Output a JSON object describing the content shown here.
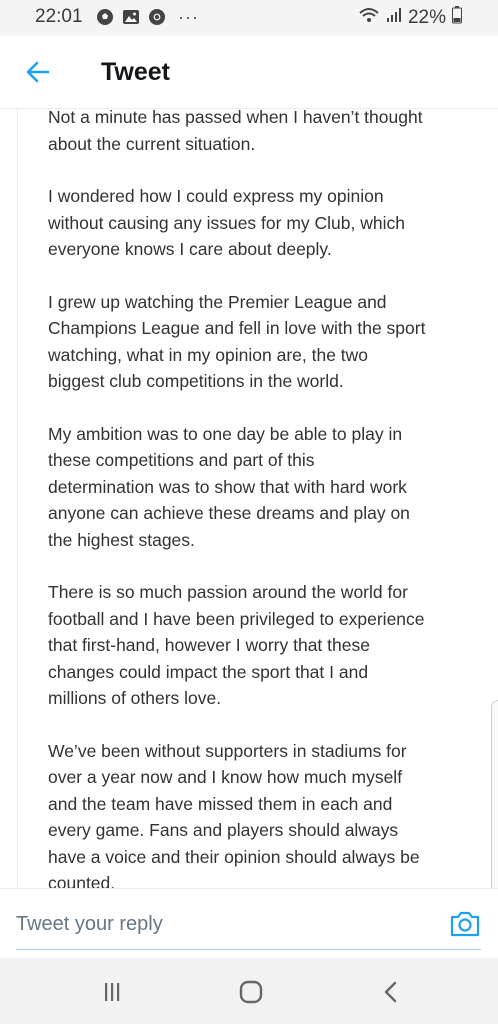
{
  "status_bar": {
    "time": "22:01",
    "icons_left": [
      "soccer-ball-icon",
      "gallery-icon",
      "chrome-icon",
      "more-dots-icon"
    ],
    "more_dots": "···",
    "battery_percent": "22%"
  },
  "header": {
    "title": "Tweet",
    "accent_color": "#1da1f2"
  },
  "tweet": {
    "paragraphs": [
      "Not a minute has passed when I haven’t thought\nabout the current situation.",
      "I wondered how I could express my opinion\nwithout causing any issues for my Club, which\neveryone knows I care about deeply.",
      "I grew up watching the Premier League and\nChampions League and fell in love with the sport\nwatching, what in my opinion are, the two\nbiggest club competitions in the world.",
      "My ambition was to one day be able to play in\nthese competitions and part of this\ndetermination was to show that with hard work\nanyone can achieve these dreams and play on\nthe highest stages.",
      "There is so much passion around the world for\nfootball and I have been privileged to experience\nthat first-hand, however I worry that these\nchanges could impact the sport that I and\nmillions of others love.",
      "We’ve been without supporters in stadiums for\nover a year now and I know how much myself\nand the team have missed them in each and\nevery game. Fans and players should always\nhave a voice and their opinion should always be\ncounted."
    ]
  },
  "reply": {
    "placeholder": "Tweet your reply"
  },
  "nav": {
    "buttons": [
      "recent-apps-icon",
      "home-icon",
      "back-icon"
    ]
  }
}
